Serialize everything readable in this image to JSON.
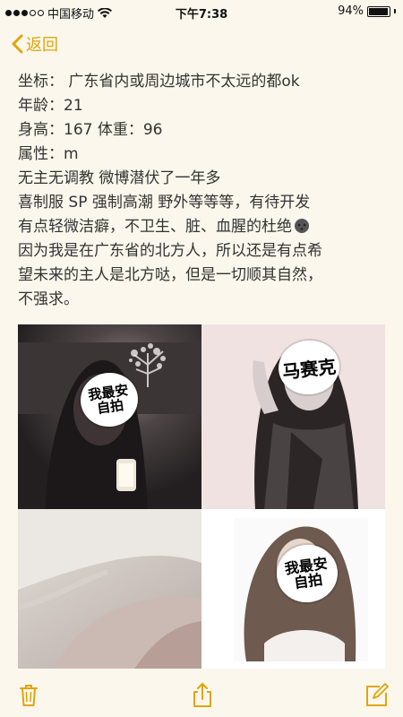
{
  "status_bar": {
    "carrier": "中国移动",
    "time": "下午7:38",
    "battery_percent": "94%",
    "battery_level": 0.94,
    "signal_filled": 3,
    "signal_total": 5
  },
  "nav": {
    "back_label": "返回"
  },
  "note": {
    "lines": [
      "坐标：  广东省内或周边城市不太远的都ok",
      "年龄：21",
      "身高：167 体重：96",
      "属性：m",
      "无主无调教 微博潜伏了一年多",
      "喜制服 SP 强制高潮 野外等等等，有待开发",
      "有点轻微洁癖，不卫生、脏、血腥的杜绝",
      "因为我是在广东省的北方人，所以还是有点希",
      "望未来的主人是北方哒，但是一切顺其自然，",
      "不强求。"
    ]
  },
  "photos": [
    {
      "sticker": "我最安自拍"
    },
    {
      "sticker": "马赛克"
    },
    {
      "sticker": ""
    },
    {
      "sticker": "我最安自拍"
    }
  ],
  "toolbar": {
    "icons": [
      "trash-icon",
      "share-icon",
      "compose-icon"
    ]
  },
  "colors": {
    "accent": "#e0a50b",
    "background": "#fbf7ec",
    "text": "#333333"
  }
}
